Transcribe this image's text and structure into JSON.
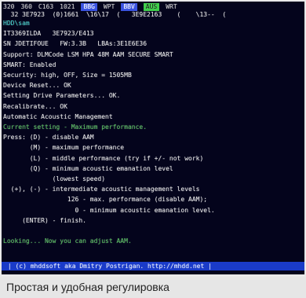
{
  "menubar": {
    "items": [
      {
        "label": "320",
        "color": "#cfcfcf",
        "bg": ""
      },
      {
        "label": "360",
        "color": "#cfcfcf",
        "bg": ""
      },
      {
        "label": "C163",
        "color": "#cfcfcf",
        "bg": ""
      },
      {
        "label": "1021",
        "color": "#cfcfcf",
        "bg": ""
      },
      {
        "label": "BBG",
        "color": "#ffffff",
        "bg": "#3a53e0"
      },
      {
        "label": "WPT",
        "color": "#cfcfcf",
        "bg": ""
      },
      {
        "label": "BBV",
        "color": "#ffffff",
        "bg": "#3a53e0"
      },
      {
        "label": "AUS",
        "color": "#101010",
        "bg": "#3fcf4a"
      },
      {
        "label": "WRT",
        "color": "#cfcfcf",
        "bg": ""
      }
    ]
  },
  "address_bar": "  32 3E7923  (0)1661  \\16\\17  (   3E9E2163    (    \\13--  (",
  "lines": [
    {
      "text": "HDD\\sam",
      "color": "cyan"
    },
    {
      "text": "IT3369ILDA   3E7923/E413",
      "color": "white"
    },
    {
      "text": "SN JDETIFOUE   FW:3.3B   LBAs:3E1E6E36",
      "color": "white"
    },
    {
      "text": "Support: DLMCode LSM HPA 48M AAM SECURE SMART",
      "color": "white"
    },
    {
      "text": "SMART: Enabled",
      "color": "white"
    },
    {
      "text": "Security: high, OFF, Size = 1505MB",
      "color": "white"
    },
    {
      "text": "Device Reset... OK",
      "color": "white"
    },
    {
      "text": "Setting Drive Parameters... OK.",
      "color": "white"
    },
    {
      "text": "Recalibrate... OK",
      "color": "white"
    },
    {
      "text": "Automatic Acoustic Management",
      "color": "white"
    },
    {
      "text": "Current setting - Maximum performance.",
      "color": "green"
    },
    {
      "text": "Press: (D) - disable AAM",
      "color": "white"
    },
    {
      "text": "       (M) - maximum performance",
      "color": "white"
    },
    {
      "text": "       (L) - middle performance (try if +/- not work)",
      "color": "white"
    },
    {
      "text": "       (Q) - minimum acoustic emanation level",
      "color": "white"
    },
    {
      "text": "             (lowest speed)",
      "color": "white"
    },
    {
      "text": "  (+), (-) - intermediate acoustic management levels",
      "color": "white"
    },
    {
      "text": "                 126 - max. performance (disable AAM);",
      "color": "white"
    },
    {
      "text": "                   0 - minimum acoustic emanation level.",
      "color": "white"
    },
    {
      "text": "     (ENTER) - finish.",
      "color": "white"
    },
    {
      "text": "",
      "color": "white"
    },
    {
      "text": "Looking... Now you can adjust AAM.",
      "color": "green"
    }
  ],
  "status_bar": " | (c) mhddsoft aka Dmitry Postrigan. http://mhdd.net |",
  "caption": "Простая и удобная регулировка",
  "colors": {
    "white": "#e8e8e8",
    "green": "#55c45c",
    "cyan": "#3fd7d0",
    "status_bg": "#1a3bc8",
    "screen_bg": "#04041c"
  }
}
